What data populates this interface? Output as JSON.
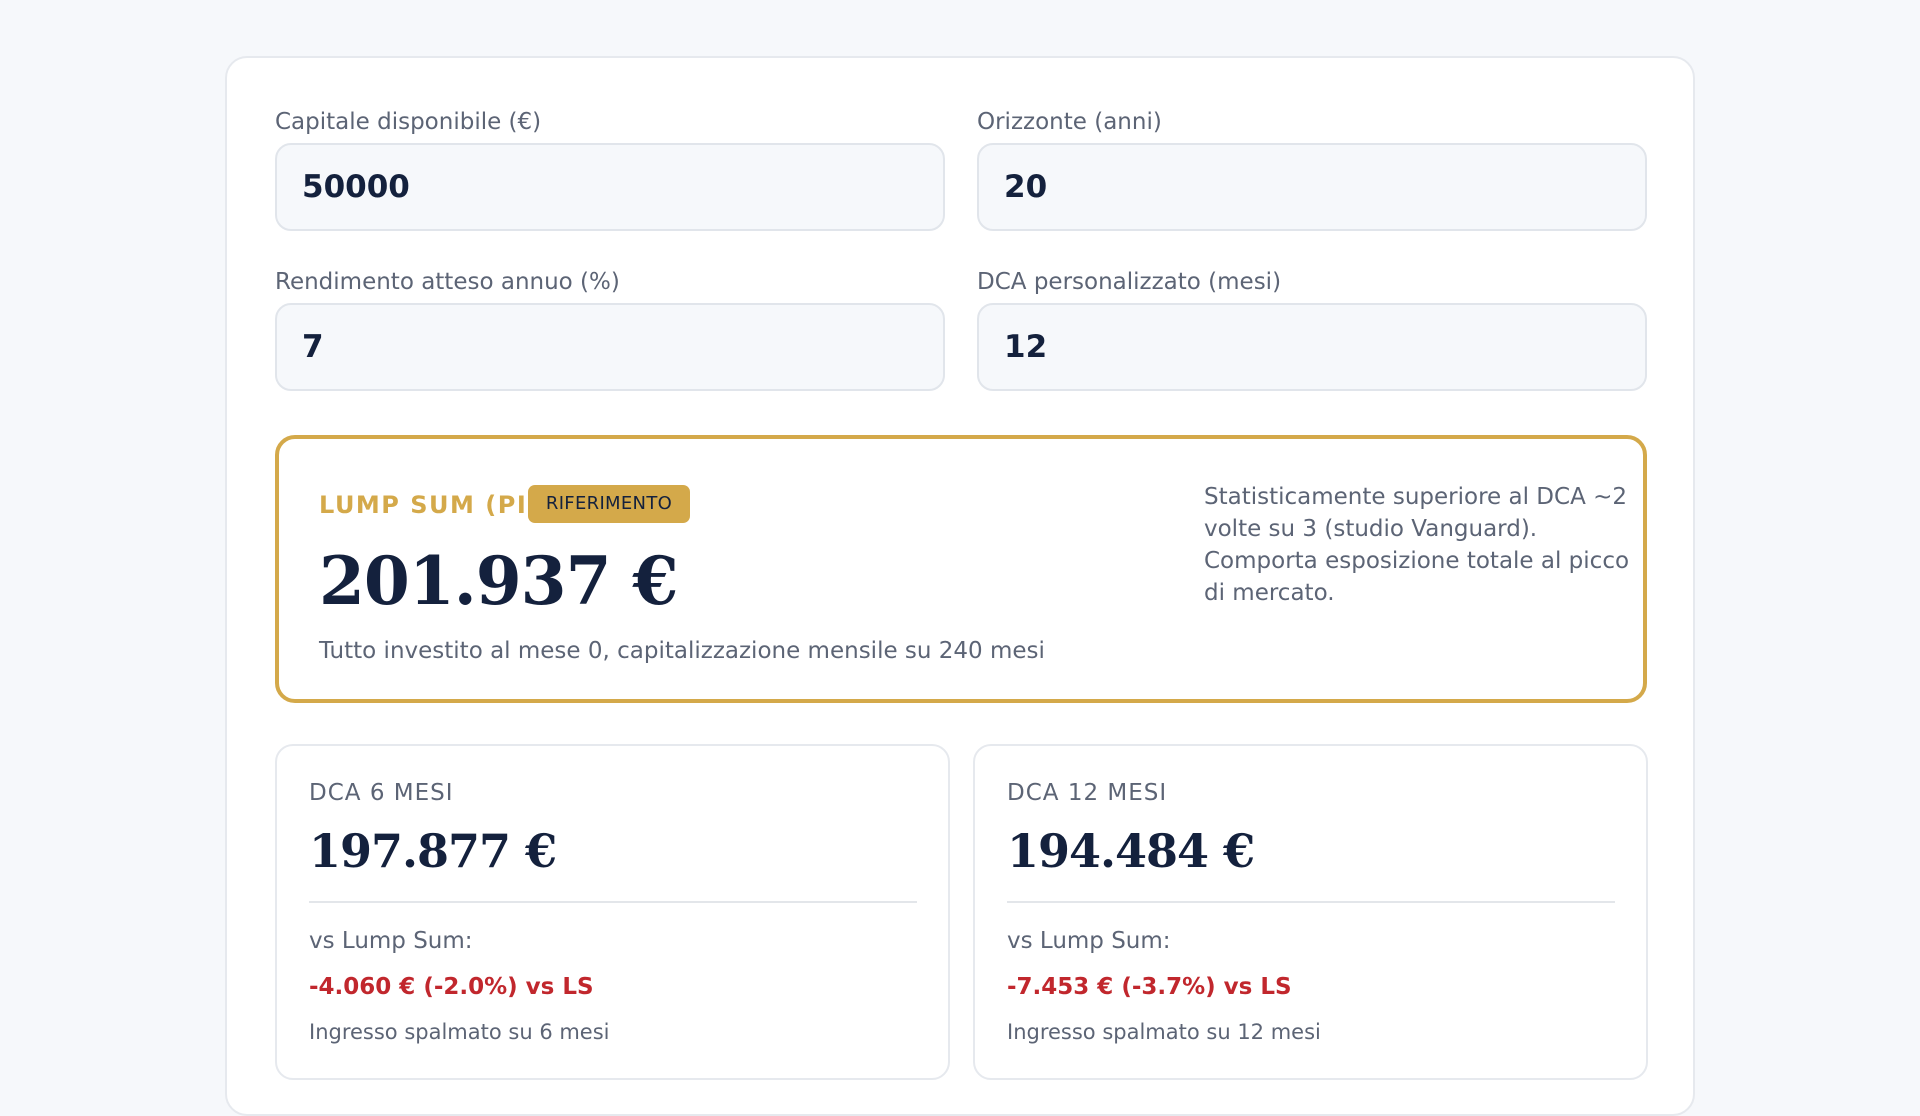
{
  "inputs": {
    "capital": {
      "label": "Capitale disponibile (€)",
      "value": "50000"
    },
    "horizon": {
      "label": "Orizzonte (anni)",
      "value": "20"
    },
    "return_rate": {
      "label": "Rendimento atteso annuo (%)",
      "value": "7"
    },
    "custom_dca": {
      "label": "DCA personalizzato (mesi)",
      "value": "12"
    }
  },
  "lump_sum": {
    "title": "LUMP SUM (PIC)",
    "badge": "RIFERIMENTO",
    "value": "201.937 €",
    "caption": "Tutto investito al mese 0, capitalizzazione mensile su 240 mesi",
    "note": "Statisticamente superiore al DCA ~2 volte su 3 (studio Vanguard). Comporta esposizione totale al picco di mercato."
  },
  "dca_cards": [
    {
      "title": "DCA 6 MESI",
      "value": "197.877 €",
      "vs_label": "vs Lump Sum:",
      "delta": "-4.060 € (-2.0%) vs LS",
      "footer": "Ingresso spalmato su 6 mesi"
    },
    {
      "title": "DCA 12 MESI",
      "value": "194.484 €",
      "vs_label": "vs Lump Sum:",
      "delta": "-7.453 € (-3.7%) vs LS",
      "footer": "Ingresso spalmato su 12 mesi"
    }
  ],
  "colors": {
    "accent_gold": "#d4a94a",
    "navy": "#14213d",
    "negative_red": "#c1272d",
    "muted_text": "#5c6475"
  }
}
